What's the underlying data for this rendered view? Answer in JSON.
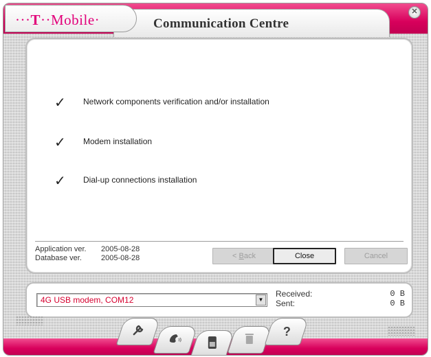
{
  "app": {
    "title": "Communication Centre",
    "logo_t": "T",
    "logo_brand": "Mobile",
    "logo_dots_left": "···",
    "logo_dots_mid": "··",
    "logo_dot_end": "·"
  },
  "steps": [
    {
      "check": "✓",
      "label": "Network components verification and/or installation"
    },
    {
      "check": "✓",
      "label": "Modem installation"
    },
    {
      "check": "✓",
      "label": "Dial-up connections installation"
    }
  ],
  "version": {
    "app_label": "Application ver.",
    "app_value": "2005-08-28",
    "db_label": "Database ver.",
    "db_value": "2005-08-28"
  },
  "buttons": {
    "back_prefix": "< ",
    "back_accel": "B",
    "back_rest": "ack",
    "close": "Close",
    "cancel": "Cancel"
  },
  "status": {
    "device": "4G USB modem, COM12",
    "received_label": "Received:",
    "received_value": "0 B",
    "sent_label": "Sent:",
    "sent_value": "0 B"
  },
  "toolbar": {
    "icons": [
      "wrench-icon",
      "phone-icon",
      "sim-card-icon",
      "trash-icon",
      "help-icon"
    ],
    "help_glyph": "?"
  },
  "colors": {
    "brand_magenta": "#e2007a",
    "device_text": "#d6002f"
  }
}
